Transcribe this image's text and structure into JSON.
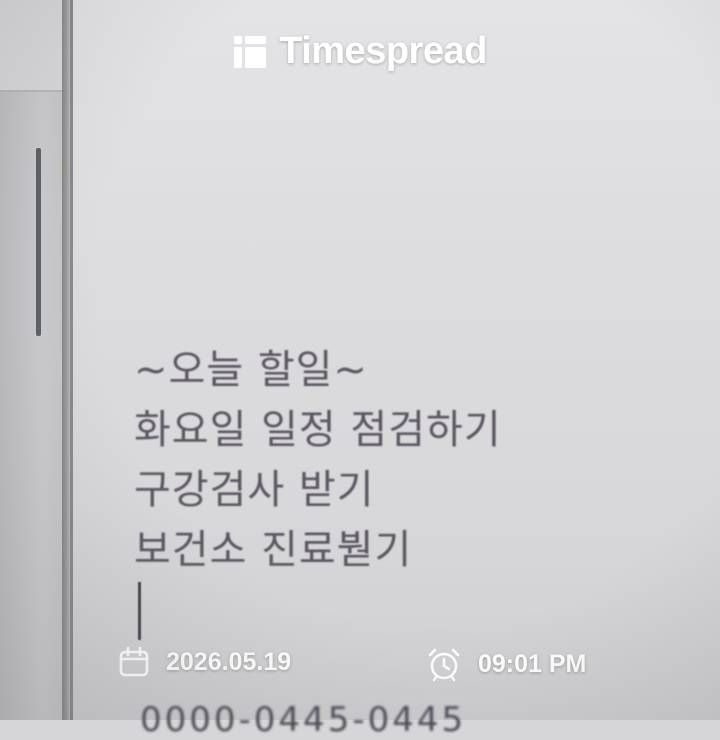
{
  "watermark": {
    "brand": "Timespread",
    "logo_icon": "timespread-logo-icon"
  },
  "note": {
    "lines": [
      "~오늘 할일~",
      "화요일 일정 점검하기",
      "구강검사 받기",
      "보건소 진료붣기"
    ],
    "partial_bottom_line": "0000-0445-0445"
  },
  "stamp": {
    "date": "2026.05.19",
    "time": "09:01 PM",
    "date_icon": "calendar-icon",
    "time_icon": "alarm-clock-icon"
  },
  "colors": {
    "note_text": "#5c5662",
    "watermark": "#ffffff",
    "scroll_line": "#4a4f55"
  }
}
